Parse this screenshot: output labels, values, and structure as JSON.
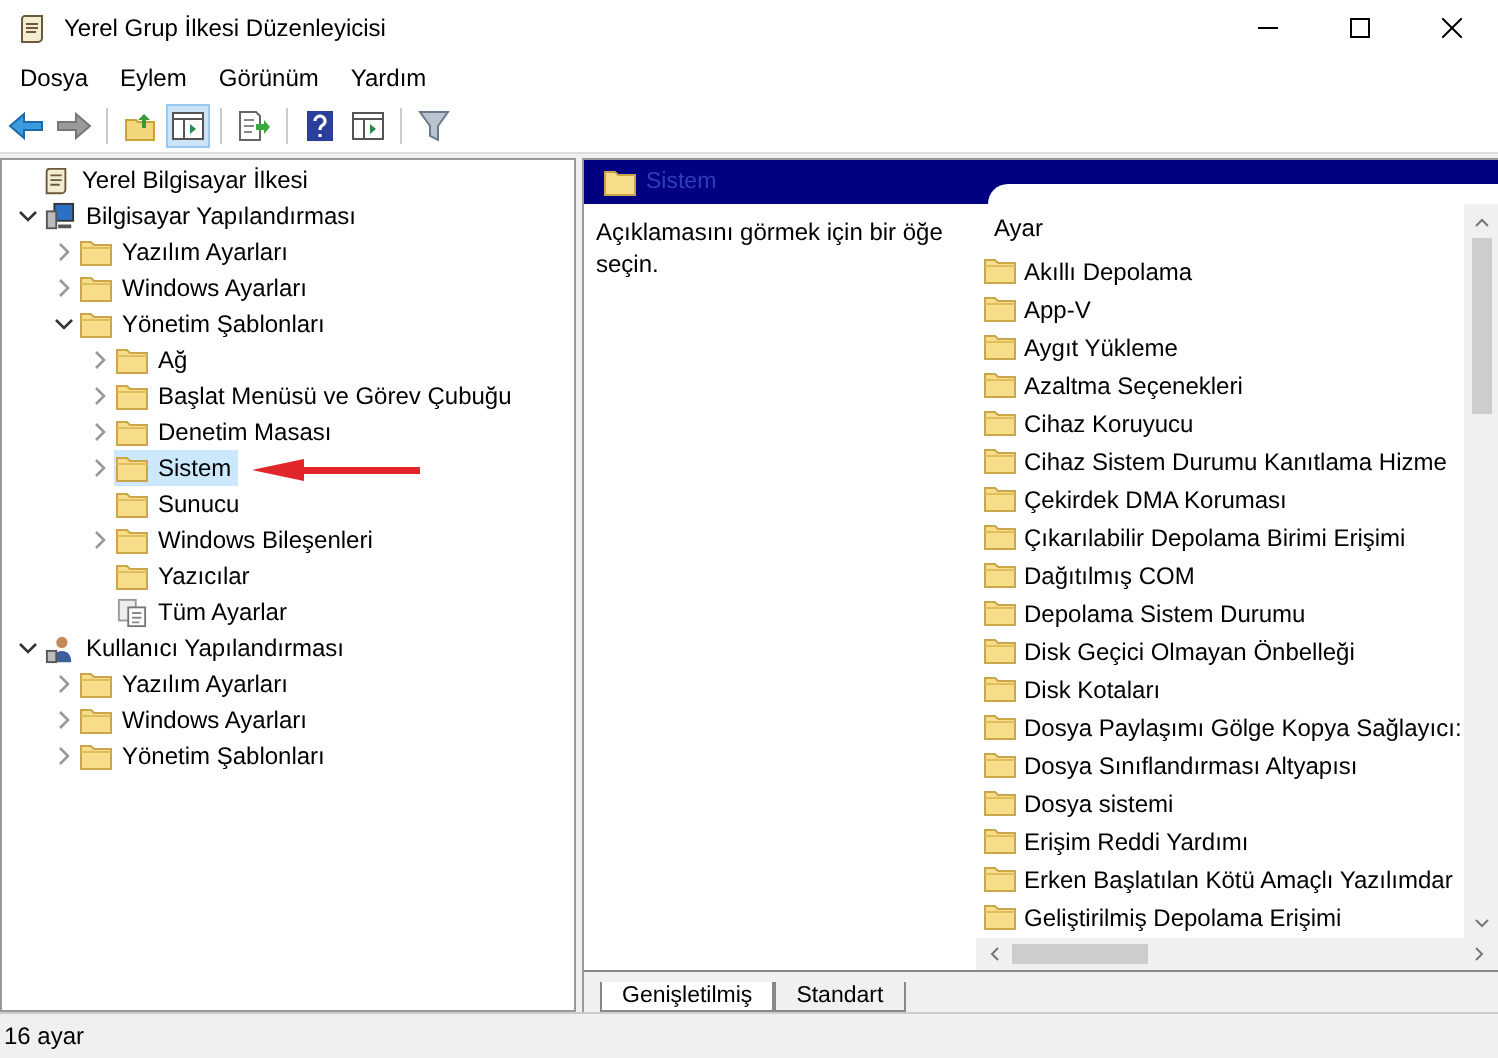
{
  "window": {
    "title": "Yerel Grup İlkesi Düzenleyicisi"
  },
  "menu": [
    "Dosya",
    "Eylem",
    "Görünüm",
    "Yardım"
  ],
  "toolbar": [
    {
      "kind": "back",
      "pressed": false
    },
    {
      "kind": "forward",
      "pressed": false
    },
    {
      "kind": "sep"
    },
    {
      "kind": "up",
      "pressed": false
    },
    {
      "kind": "pane",
      "pressed": true
    },
    {
      "kind": "sep"
    },
    {
      "kind": "export",
      "pressed": false
    },
    {
      "kind": "sep"
    },
    {
      "kind": "help",
      "pressed": false
    },
    {
      "kind": "pane2",
      "pressed": false
    },
    {
      "kind": "sep"
    },
    {
      "kind": "filter",
      "pressed": false
    }
  ],
  "tree": [
    {
      "label": "Yerel Bilgisayar İlkesi",
      "kind": "scroll",
      "children": [
        {
          "label": "Bilgisayar Yapılandırması",
          "kind": "computer",
          "expanded": true,
          "children": [
            {
              "label": "Yazılım Ayarları",
              "kind": "folder",
              "expanded": false,
              "has_children": true,
              "selected": false
            },
            {
              "label": "Windows Ayarları",
              "kind": "folder",
              "expanded": false,
              "has_children": true,
              "selected": false
            },
            {
              "label": "Yönetim Şablonları",
              "kind": "folder",
              "expanded": true,
              "has_children": true,
              "selected": false,
              "children": [
                {
                  "label": "Ağ",
                  "kind": "folder",
                  "expanded": false,
                  "has_children": true,
                  "selected": false
                },
                {
                  "label": "Başlat Menüsü ve Görev Çubuğu",
                  "kind": "folder",
                  "expanded": false,
                  "has_children": true,
                  "selected": false
                },
                {
                  "label": "Denetim Masası",
                  "kind": "folder",
                  "expanded": false,
                  "has_children": true,
                  "selected": false
                },
                {
                  "label": "Sistem",
                  "kind": "folder",
                  "expanded": false,
                  "has_children": true,
                  "selected": true
                },
                {
                  "label": "Sunucu",
                  "kind": "folder",
                  "expanded": false,
                  "has_children": false,
                  "selected": false
                },
                {
                  "label": "Windows Bileşenleri",
                  "kind": "folder",
                  "expanded": false,
                  "has_children": true,
                  "selected": false
                },
                {
                  "label": "Yazıcılar",
                  "kind": "folder",
                  "expanded": false,
                  "has_children": false,
                  "selected": false
                },
                {
                  "label": "Tüm Ayarlar",
                  "kind": "settings",
                  "expanded": false,
                  "has_children": false,
                  "selected": false
                }
              ]
            }
          ]
        },
        {
          "label": "Kullanıcı Yapılandırması",
          "kind": "user",
          "expanded": true,
          "children": [
            {
              "label": "Yazılım Ayarları",
              "kind": "folder",
              "expanded": false,
              "has_children": true,
              "selected": false
            },
            {
              "label": "Windows Ayarları",
              "kind": "folder",
              "expanded": false,
              "has_children": true,
              "selected": false
            },
            {
              "label": "Yönetim Şablonları",
              "kind": "folder",
              "expanded": false,
              "has_children": true,
              "selected": false
            }
          ]
        }
      ]
    }
  ],
  "detail": {
    "header": "Sistem",
    "description": "Açıklamasını görmek için bir öğe seçin.",
    "column": "Ayar",
    "items": [
      "Akıllı Depolama",
      "App-V",
      "Aygıt Yükleme",
      "Azaltma Seçenekleri",
      "Cihaz Koruyucu",
      "Cihaz Sistem Durumu Kanıtlama Hizme",
      "Çekirdek DMA Koruması",
      "Çıkarılabilir Depolama Birimi Erişimi",
      "Dağıtılmış COM",
      "Depolama Sistem Durumu",
      "Disk Geçici Olmayan Önbelleği",
      "Disk Kotaları",
      "Dosya Paylaşımı Gölge Kopya Sağlayıcı:",
      "Dosya Sınıflandırması Altyapısı",
      "Dosya sistemi",
      "Erişim Reddi Yardımı",
      "Erken Başlatılan Kötü Amaçlı Yazılımdar",
      "Geliştirilmiş Depolama Erişimi"
    ]
  },
  "tabs": [
    {
      "label": "Genişletilmiş",
      "selected": true
    },
    {
      "label": "Standart",
      "selected": false
    }
  ],
  "status_bar": "16 ayar"
}
